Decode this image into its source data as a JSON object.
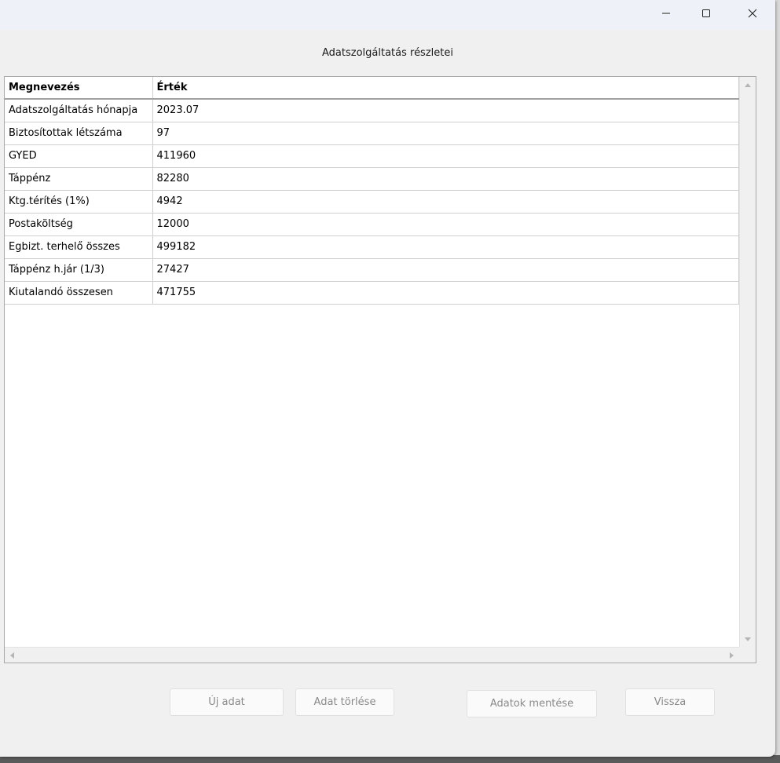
{
  "window": {
    "title": "Adatszolgáltatás részletei",
    "controls": {
      "minimize": "minimize",
      "maximize": "maximize",
      "close": "close"
    }
  },
  "table": {
    "headers": [
      "Megnevezés",
      "Érték"
    ],
    "rows": [
      {
        "name": "Adatszolgáltatás hónapja",
        "value": "2023.07"
      },
      {
        "name": "Biztosítottak létszáma",
        "value": "97"
      },
      {
        "name": "GYED",
        "value": "411960"
      },
      {
        "name": "Táppénz",
        "value": "82280"
      },
      {
        "name": "Ktg.térítés (1%)",
        "value": "4942"
      },
      {
        "name": "Postaköltség",
        "value": "12000"
      },
      {
        "name": "Egbizt. terhelő összes",
        "value": "499182"
      },
      {
        "name": "Táppénz h.jár (1/3)",
        "value": "27427"
      },
      {
        "name": "Kiutalandó összesen",
        "value": "471755"
      }
    ]
  },
  "buttons": {
    "new": "Új adat",
    "delete": "Adat törlése",
    "save": "Adatok mentése",
    "back": "Vissza"
  },
  "colors": {
    "titlebar": "#eef1f7",
    "window": "#f0f0f0",
    "disabled_text": "#8a8a8a"
  }
}
